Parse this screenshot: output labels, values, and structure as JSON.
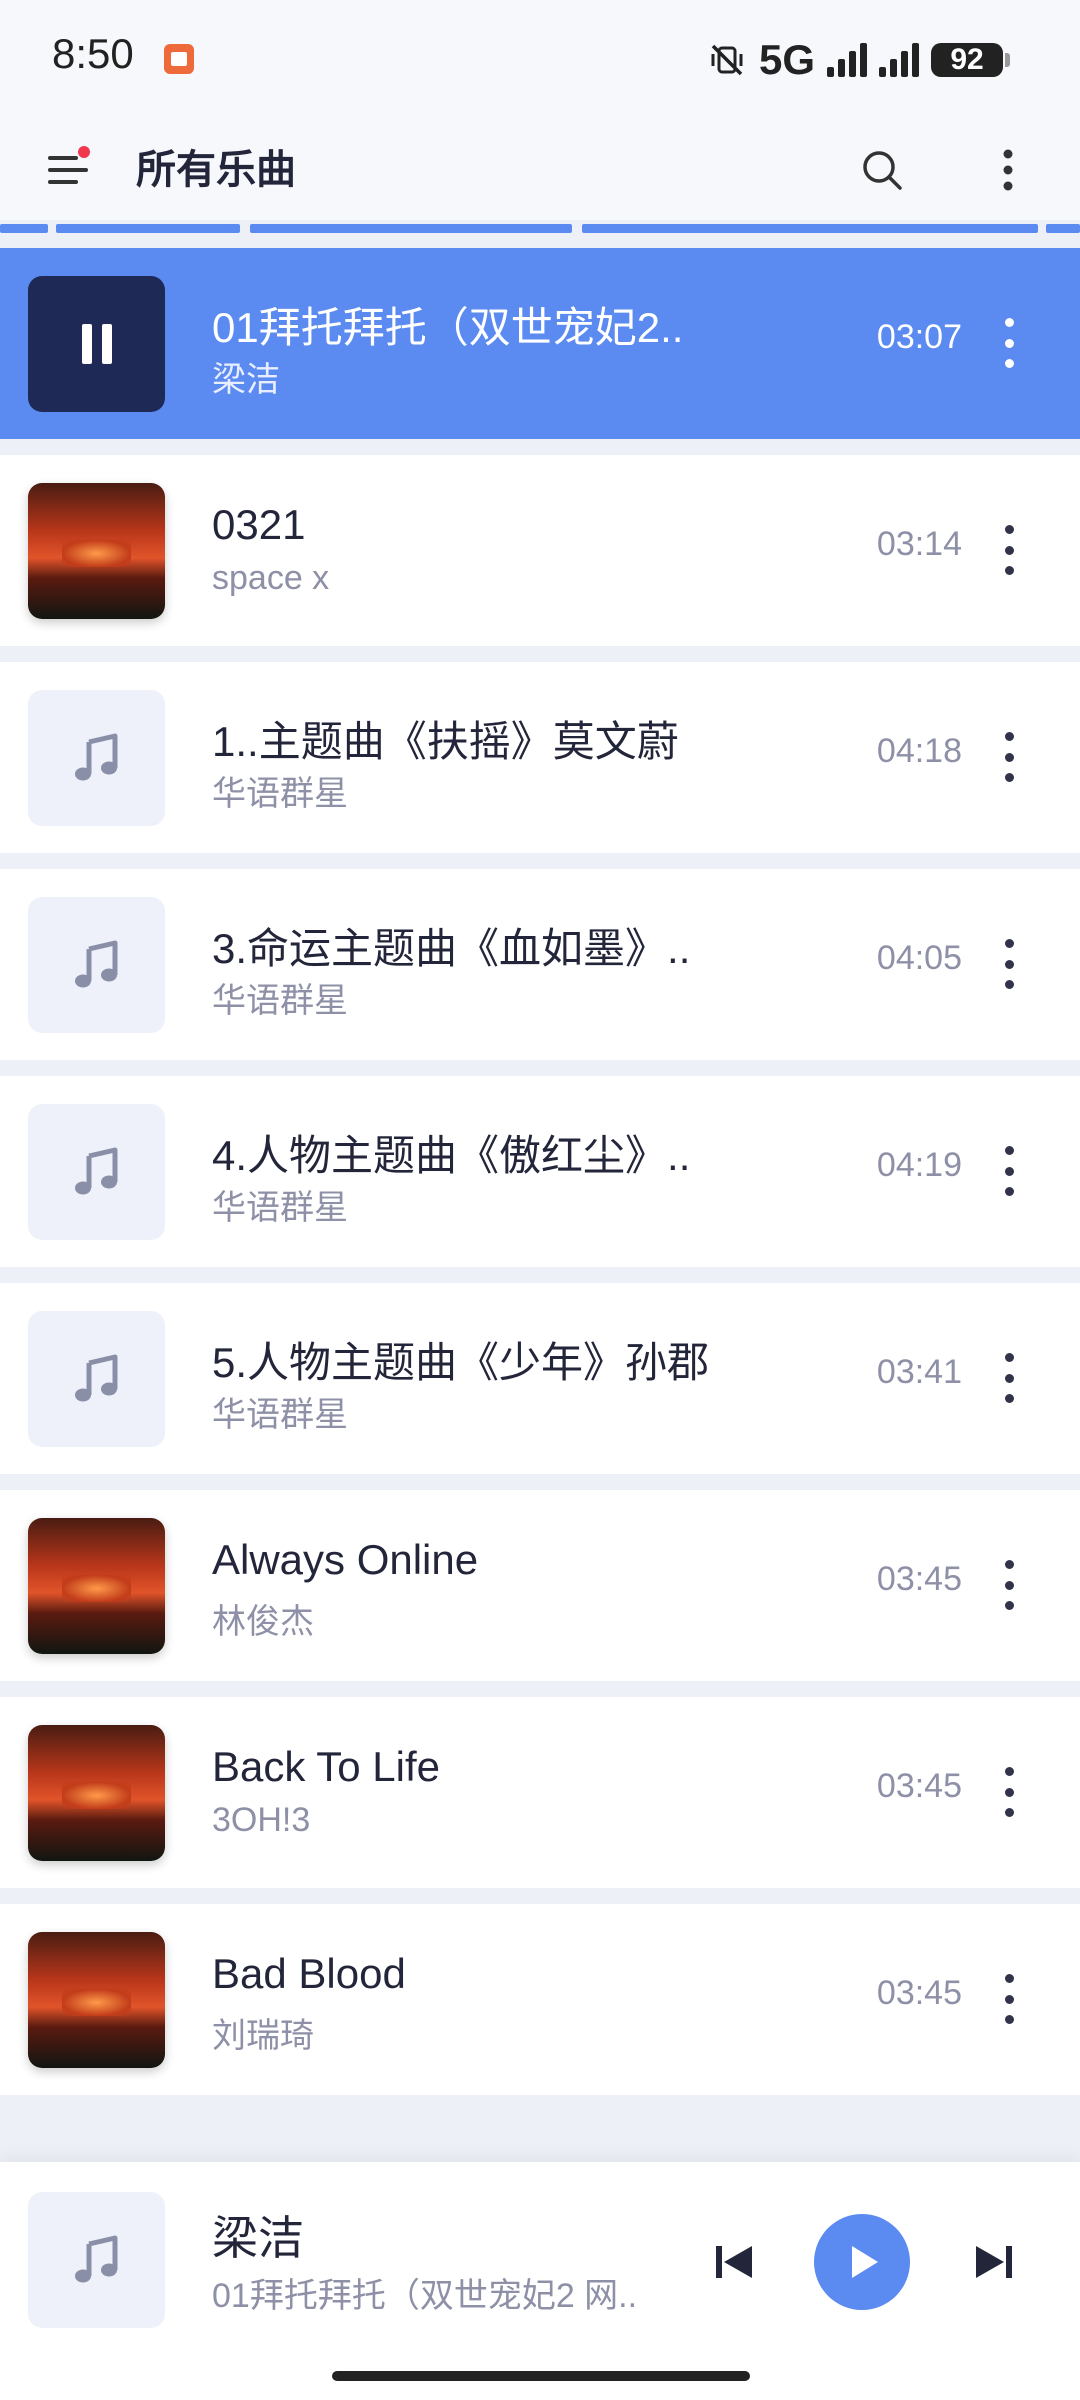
{
  "status_bar": {
    "time": "8:50",
    "network": "5G",
    "battery": "92"
  },
  "app_bar": {
    "title": "所有乐曲"
  },
  "songs": [
    {
      "title": "01拜托拜托（双世宠妃2..",
      "artist": "梁洁",
      "duration": "03:07",
      "thumb": "pause",
      "active": true
    },
    {
      "title": "0321",
      "artist": "space x",
      "duration": "03:14",
      "thumb": "cover",
      "active": false
    },
    {
      "title": "1..主题曲《扶摇》莫文蔚",
      "artist": "华语群星",
      "duration": "04:18",
      "thumb": "note",
      "active": false
    },
    {
      "title": "3.命运主题曲《血如墨》..",
      "artist": "华语群星",
      "duration": "04:05",
      "thumb": "note",
      "active": false
    },
    {
      "title": "4.人物主题曲《傲红尘》..",
      "artist": "华语群星",
      "duration": "04:19",
      "thumb": "note",
      "active": false
    },
    {
      "title": "5.人物主题曲《少年》孙郡",
      "artist": "华语群星",
      "duration": "03:41",
      "thumb": "note",
      "active": false
    },
    {
      "title": "Always Online",
      "artist": "林俊杰",
      "duration": "03:45",
      "thumb": "cover",
      "active": false
    },
    {
      "title": "Back To Life",
      "artist": "3OH!3",
      "duration": "03:45",
      "thumb": "cover",
      "active": false
    },
    {
      "title": "Bad Blood",
      "artist": "刘瑞琦",
      "duration": "03:45",
      "thumb": "cover",
      "active": false
    }
  ],
  "mini_player": {
    "artist": "梁洁",
    "title": "01拜托拜托（双世宠妃2 网.."
  },
  "colors": {
    "accent": "#5b8af0",
    "background": "#eef0f7",
    "active_thumb": "#1e2a55"
  }
}
